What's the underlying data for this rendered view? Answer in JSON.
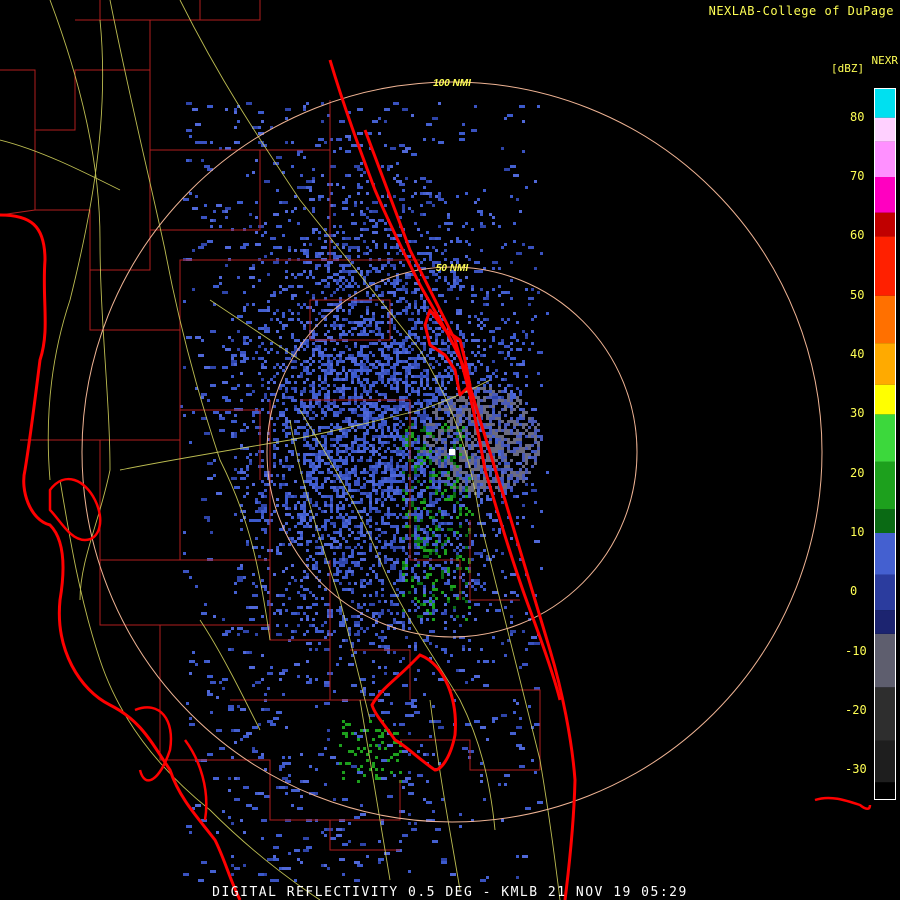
{
  "credit": "NEXLAB-College of DuPage",
  "product": "NEXR",
  "units": "[dBZ]",
  "caption": "DIGITAL REFLECTIVITY 0.5 DEG - KMLB 21 NOV 19 05:29",
  "range_rings": [
    {
      "label": "50 NMI"
    },
    {
      "label": "100 NMI"
    }
  ],
  "colorbar": {
    "ticks": [
      "80",
      "70",
      "60",
      "50",
      "40",
      "30",
      "20",
      "10",
      "0",
      "-10",
      "-20",
      "-30"
    ],
    "range_dbz": [
      -35,
      85
    ],
    "bands": [
      {
        "from": -35,
        "to": -32,
        "color": "#000000"
      },
      {
        "from": -32,
        "to": -25,
        "color": "#1e1e1e"
      },
      {
        "from": -25,
        "to": -16,
        "color": "#2e2e2e"
      },
      {
        "from": -16,
        "to": -7,
        "color": "#5e5e6e"
      },
      {
        "from": -7,
        "to": -3,
        "color": "#1c2470"
      },
      {
        "from": -3,
        "to": 3,
        "color": "#2b3c9e"
      },
      {
        "from": 3,
        "to": 10,
        "color": "#4460d0"
      },
      {
        "from": 10,
        "to": 14,
        "color": "#0a6a14"
      },
      {
        "from": 14,
        "to": 22,
        "color": "#1da01d"
      },
      {
        "from": 22,
        "to": 30,
        "color": "#3cd83c"
      },
      {
        "from": 30,
        "to": 35,
        "color": "#ffff00"
      },
      {
        "from": 35,
        "to": 42,
        "color": "#ffaa00"
      },
      {
        "from": 42,
        "to": 50,
        "color": "#ff7000"
      },
      {
        "from": 50,
        "to": 60,
        "color": "#ff2000"
      },
      {
        "from": 60,
        "to": 64,
        "color": "#c00000"
      },
      {
        "from": 64,
        "to": 70,
        "color": "#ff00c0"
      },
      {
        "from": 70,
        "to": 76,
        "color": "#ff90ff"
      },
      {
        "from": 76,
        "to": 80,
        "color": "#ffd0ff"
      },
      {
        "from": 80,
        "to": 85,
        "color": "#00e0f0"
      }
    ]
  },
  "colors": {
    "coastline": "#ff0000",
    "county_lines": "#b01e1e",
    "roads": "#dede60",
    "range_ring": "#f0b494",
    "ring_label": "#ffff55"
  }
}
